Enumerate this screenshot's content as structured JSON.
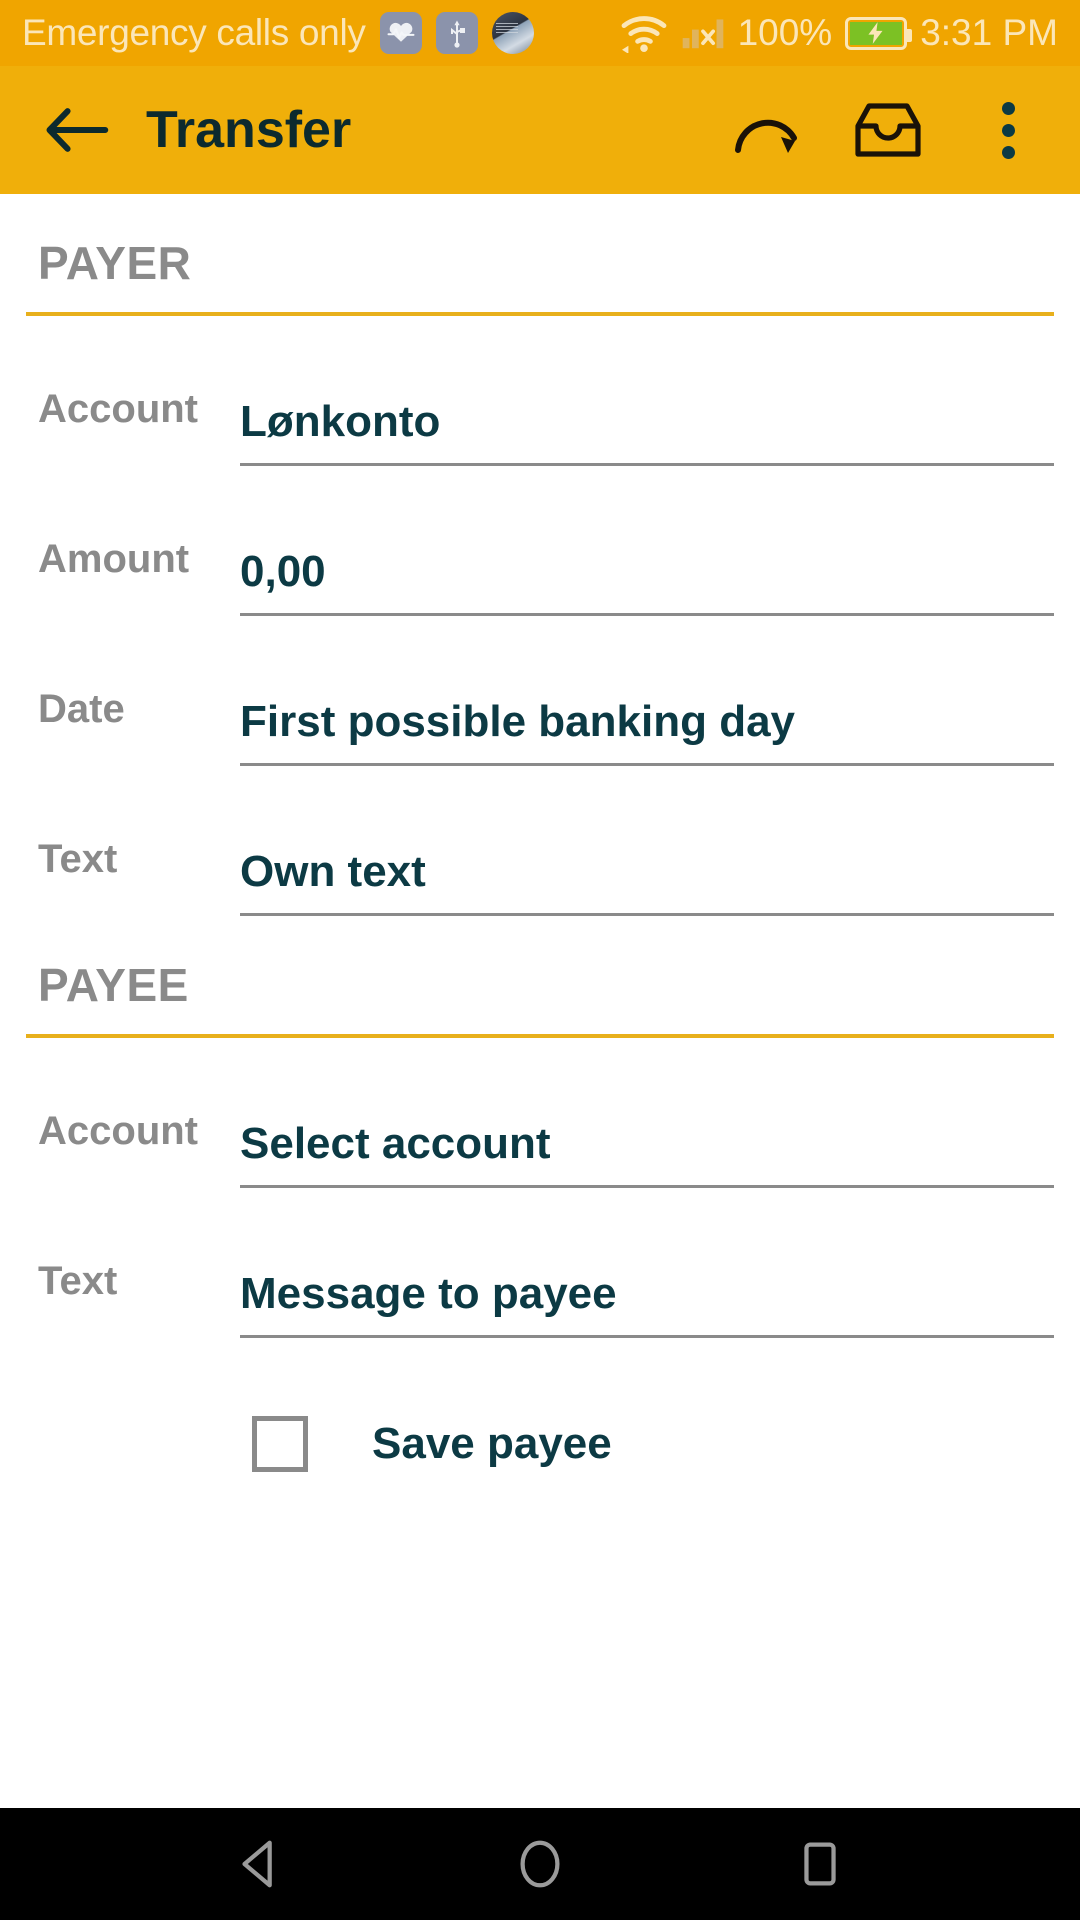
{
  "status_bar": {
    "carrier_text": "Emergency calls only",
    "icons": [
      "heart-rate-icon",
      "usb-icon",
      "photo-notification-icon",
      "wifi-icon",
      "signal-no-sim-icon"
    ],
    "battery_percent": "100%",
    "battery_state": "charging",
    "time": "3:31 PM",
    "bg_color": "#F0A500",
    "text_color": "#FBE6B8",
    "battery_fill_color": "#7CC124"
  },
  "app_bar": {
    "title": "Transfer",
    "back_icon": "arrow-left-icon",
    "actions": [
      {
        "name": "repeat-transfer-icon"
      },
      {
        "name": "inbox-tray-icon"
      },
      {
        "name": "overflow-menu-icon"
      }
    ],
    "bg_color": "#F0AF0A",
    "title_color": "#0C2A2E"
  },
  "sections": [
    {
      "title": "PAYER",
      "rule_color": "#E8B01C",
      "fields": [
        {
          "label": "Account",
          "value": "Lønkonto"
        },
        {
          "label": "Amount",
          "value": "0,00"
        },
        {
          "label": "Date",
          "value": "First possible banking day"
        },
        {
          "label": "Text",
          "value": "Own text"
        }
      ]
    },
    {
      "title": "PAYEE",
      "rule_color": "#E8B01C",
      "fields": [
        {
          "label": "Account",
          "value": "Select account"
        },
        {
          "label": "Text",
          "value": "Message to payee"
        }
      ]
    }
  ],
  "save_payee": {
    "label": "Save payee",
    "checked": false
  },
  "nav_bar": {
    "buttons": [
      {
        "name": "nav-back-icon"
      },
      {
        "name": "nav-home-icon"
      },
      {
        "name": "nav-recents-icon"
      }
    ],
    "bg_color": "#000000",
    "icon_color": "#9a9a9a"
  }
}
